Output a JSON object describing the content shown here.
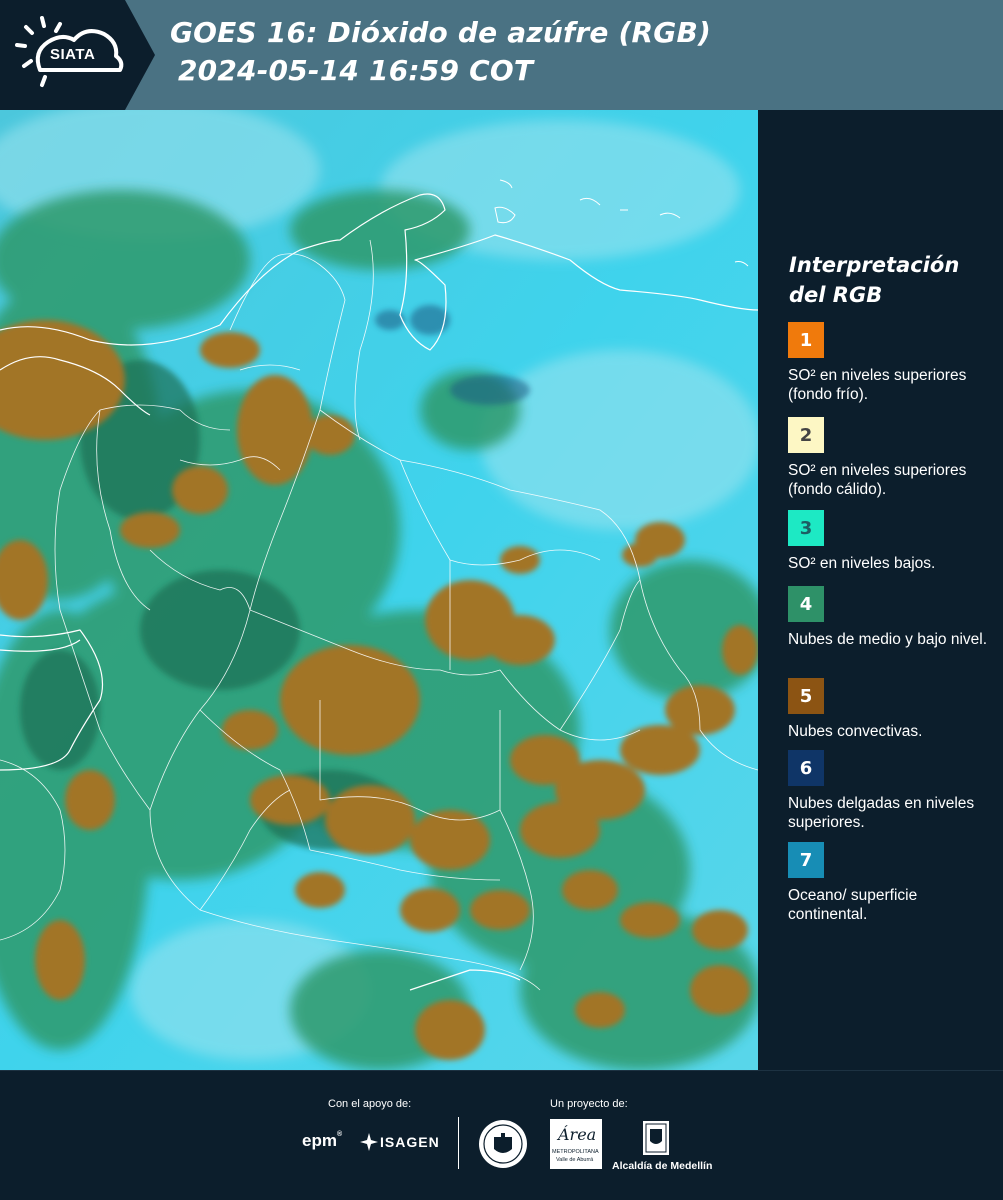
{
  "header": {
    "logo_text": "SIATA",
    "title": "GOES 16: Dióxido de azúfre (RGB)",
    "datetime": "2024-05-14 16:59 COT"
  },
  "legend": {
    "title_line1": "Interpretación",
    "title_line2": "del RGB",
    "items": [
      {
        "number": "1",
        "color": "#f07a0c",
        "number_color": "#ffffff",
        "label": "SO² en niveles superiores (fondo frío)."
      },
      {
        "number": "2",
        "color": "#fdf7c4",
        "number_color": "#444444",
        "label": "SO² en niveles superiores (fondo cálido)."
      },
      {
        "number": "3",
        "color": "#1de9c4",
        "number_color": "#1d5e63",
        "label": "SO² en niveles bajos."
      },
      {
        "number": "4",
        "color": "#2e9168",
        "number_color": "#ffffff",
        "label": "Nubes de medio y bajo nivel."
      },
      {
        "number": "5",
        "color": "#8c5413",
        "number_color": "#ffffff",
        "label": "Nubes convectivas."
      },
      {
        "number": "6",
        "color": "#0f3567",
        "number_color": "#ffffff",
        "label": "Nubes delgadas en niveles superiores."
      },
      {
        "number": "7",
        "color": "#178db5",
        "number_color": "#ffffff",
        "label": "Oceano/ superficie continental."
      }
    ]
  },
  "footer": {
    "support_label": "Con el apoyo de:",
    "project_label": "Un proyecto de:",
    "epm_text": "epm",
    "isagen_text": "ISAGEN",
    "area_text": "Área",
    "area_sub1": "METROPOLITANA",
    "area_sub2": "Valle de Aburrá",
    "alcaldia_text": "Alcaldía de Medellín"
  }
}
